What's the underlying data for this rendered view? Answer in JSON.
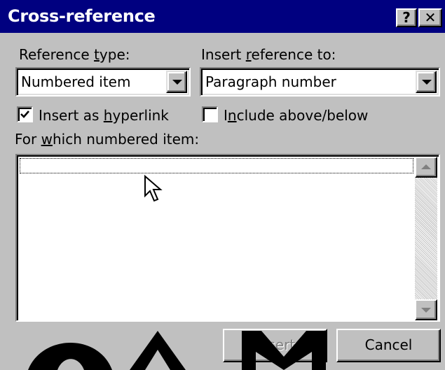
{
  "window": {
    "title": "Cross-reference",
    "help_button": "?",
    "close_button": "✕"
  },
  "reference_type": {
    "label_pre": "Reference ",
    "label_accel": "t",
    "label_post": "ype:",
    "value": "Numbered item"
  },
  "insert_reference_to": {
    "label_pre": "Insert ",
    "label_accel": "r",
    "label_post": "eference to:",
    "value": "Paragraph number"
  },
  "insert_as_hyperlink": {
    "checked": true,
    "label_pre": "Insert as ",
    "label_accel": "h",
    "label_post": "yperlink"
  },
  "include_above_below": {
    "checked": false,
    "label_pre": "I",
    "label_accel": "n",
    "label_post": "clude above/below"
  },
  "for_which": {
    "label_pre": "For ",
    "label_accel": "w",
    "label_post": "hich numbered item:",
    "items": []
  },
  "buttons": {
    "insert": "Insert",
    "cancel": "Cancel"
  },
  "colors": {
    "title_bar": "#000080",
    "face": "#c0c0c0",
    "watermark": "#000000"
  }
}
